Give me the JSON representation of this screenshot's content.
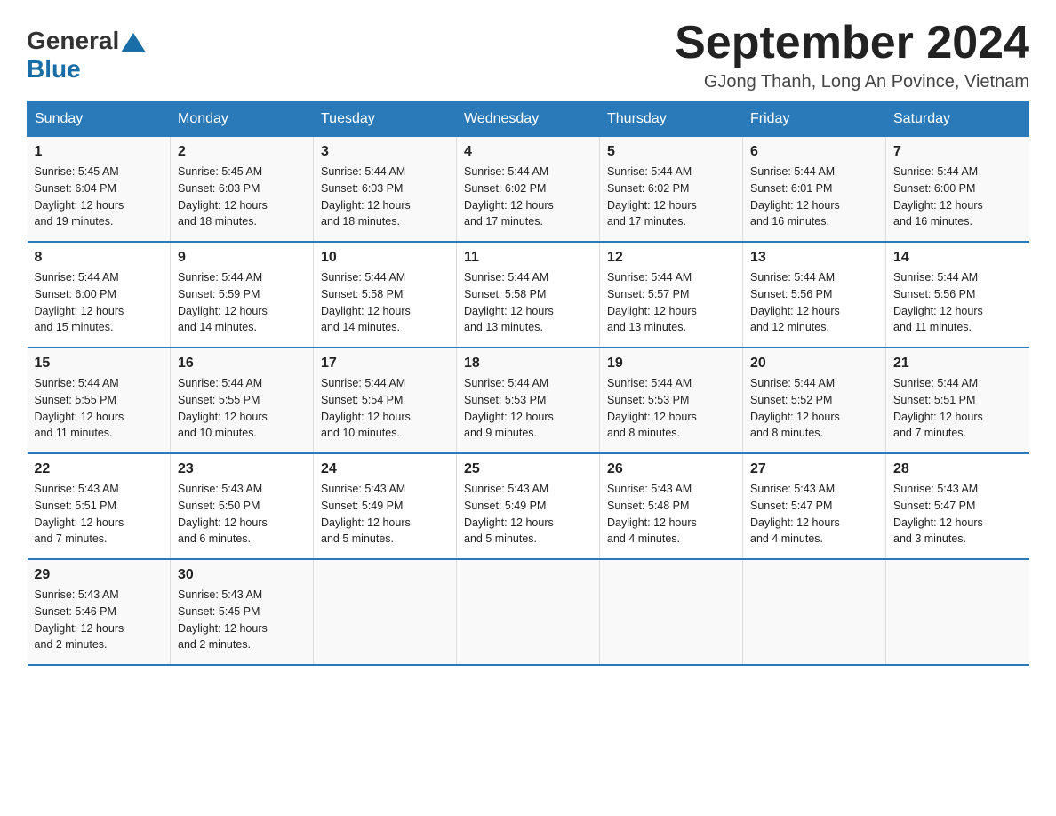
{
  "header": {
    "logo_general": "General",
    "logo_blue": "Blue",
    "month_title": "September 2024",
    "subtitle": "GJong Thanh, Long An Povince, Vietnam"
  },
  "calendar": {
    "days_of_week": [
      "Sunday",
      "Monday",
      "Tuesday",
      "Wednesday",
      "Thursday",
      "Friday",
      "Saturday"
    ],
    "weeks": [
      [
        {
          "day": "1",
          "info": "Sunrise: 5:45 AM\nSunset: 6:04 PM\nDaylight: 12 hours\nand 19 minutes."
        },
        {
          "day": "2",
          "info": "Sunrise: 5:45 AM\nSunset: 6:03 PM\nDaylight: 12 hours\nand 18 minutes."
        },
        {
          "day": "3",
          "info": "Sunrise: 5:44 AM\nSunset: 6:03 PM\nDaylight: 12 hours\nand 18 minutes."
        },
        {
          "day": "4",
          "info": "Sunrise: 5:44 AM\nSunset: 6:02 PM\nDaylight: 12 hours\nand 17 minutes."
        },
        {
          "day": "5",
          "info": "Sunrise: 5:44 AM\nSunset: 6:02 PM\nDaylight: 12 hours\nand 17 minutes."
        },
        {
          "day": "6",
          "info": "Sunrise: 5:44 AM\nSunset: 6:01 PM\nDaylight: 12 hours\nand 16 minutes."
        },
        {
          "day": "7",
          "info": "Sunrise: 5:44 AM\nSunset: 6:00 PM\nDaylight: 12 hours\nand 16 minutes."
        }
      ],
      [
        {
          "day": "8",
          "info": "Sunrise: 5:44 AM\nSunset: 6:00 PM\nDaylight: 12 hours\nand 15 minutes."
        },
        {
          "day": "9",
          "info": "Sunrise: 5:44 AM\nSunset: 5:59 PM\nDaylight: 12 hours\nand 14 minutes."
        },
        {
          "day": "10",
          "info": "Sunrise: 5:44 AM\nSunset: 5:58 PM\nDaylight: 12 hours\nand 14 minutes."
        },
        {
          "day": "11",
          "info": "Sunrise: 5:44 AM\nSunset: 5:58 PM\nDaylight: 12 hours\nand 13 minutes."
        },
        {
          "day": "12",
          "info": "Sunrise: 5:44 AM\nSunset: 5:57 PM\nDaylight: 12 hours\nand 13 minutes."
        },
        {
          "day": "13",
          "info": "Sunrise: 5:44 AM\nSunset: 5:56 PM\nDaylight: 12 hours\nand 12 minutes."
        },
        {
          "day": "14",
          "info": "Sunrise: 5:44 AM\nSunset: 5:56 PM\nDaylight: 12 hours\nand 11 minutes."
        }
      ],
      [
        {
          "day": "15",
          "info": "Sunrise: 5:44 AM\nSunset: 5:55 PM\nDaylight: 12 hours\nand 11 minutes."
        },
        {
          "day": "16",
          "info": "Sunrise: 5:44 AM\nSunset: 5:55 PM\nDaylight: 12 hours\nand 10 minutes."
        },
        {
          "day": "17",
          "info": "Sunrise: 5:44 AM\nSunset: 5:54 PM\nDaylight: 12 hours\nand 10 minutes."
        },
        {
          "day": "18",
          "info": "Sunrise: 5:44 AM\nSunset: 5:53 PM\nDaylight: 12 hours\nand 9 minutes."
        },
        {
          "day": "19",
          "info": "Sunrise: 5:44 AM\nSunset: 5:53 PM\nDaylight: 12 hours\nand 8 minutes."
        },
        {
          "day": "20",
          "info": "Sunrise: 5:44 AM\nSunset: 5:52 PM\nDaylight: 12 hours\nand 8 minutes."
        },
        {
          "day": "21",
          "info": "Sunrise: 5:44 AM\nSunset: 5:51 PM\nDaylight: 12 hours\nand 7 minutes."
        }
      ],
      [
        {
          "day": "22",
          "info": "Sunrise: 5:43 AM\nSunset: 5:51 PM\nDaylight: 12 hours\nand 7 minutes."
        },
        {
          "day": "23",
          "info": "Sunrise: 5:43 AM\nSunset: 5:50 PM\nDaylight: 12 hours\nand 6 minutes."
        },
        {
          "day": "24",
          "info": "Sunrise: 5:43 AM\nSunset: 5:49 PM\nDaylight: 12 hours\nand 5 minutes."
        },
        {
          "day": "25",
          "info": "Sunrise: 5:43 AM\nSunset: 5:49 PM\nDaylight: 12 hours\nand 5 minutes."
        },
        {
          "day": "26",
          "info": "Sunrise: 5:43 AM\nSunset: 5:48 PM\nDaylight: 12 hours\nand 4 minutes."
        },
        {
          "day": "27",
          "info": "Sunrise: 5:43 AM\nSunset: 5:47 PM\nDaylight: 12 hours\nand 4 minutes."
        },
        {
          "day": "28",
          "info": "Sunrise: 5:43 AM\nSunset: 5:47 PM\nDaylight: 12 hours\nand 3 minutes."
        }
      ],
      [
        {
          "day": "29",
          "info": "Sunrise: 5:43 AM\nSunset: 5:46 PM\nDaylight: 12 hours\nand 2 minutes."
        },
        {
          "day": "30",
          "info": "Sunrise: 5:43 AM\nSunset: 5:45 PM\nDaylight: 12 hours\nand 2 minutes."
        },
        {
          "day": "",
          "info": ""
        },
        {
          "day": "",
          "info": ""
        },
        {
          "day": "",
          "info": ""
        },
        {
          "day": "",
          "info": ""
        },
        {
          "day": "",
          "info": ""
        }
      ]
    ]
  }
}
